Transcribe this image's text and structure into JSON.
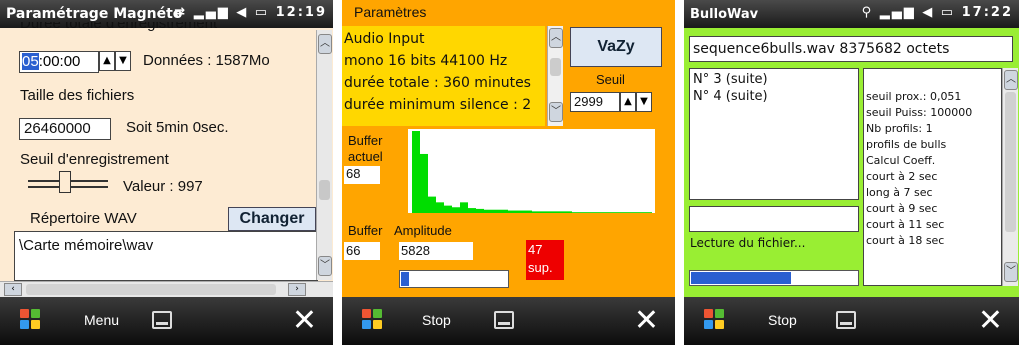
{
  "screen1": {
    "title": "Paramétrage Magnéto",
    "clock": "12:19",
    "partial_top_label": "Durée totale d'enregistrement",
    "duration_highlight": "05",
    "duration_rest": ":00:00",
    "data_label": "Données : 1587Mo",
    "file_size_label": "Taille des fichiers",
    "file_size_value": "26460000",
    "file_duration": "Soit 5min 0sec.",
    "threshold_label": "Seuil d'enregistrement",
    "threshold_value": "Valeur : 997",
    "threshold_fraction": 0.45,
    "wav_dir_label": "Répertoire WAV",
    "change_button": "Changer",
    "wav_path": "\\Carte mémoire\\wav",
    "menu_label": "Menu"
  },
  "screen2": {
    "params_label": "Paramètres",
    "input_lines": [
      "Audio Input",
      "mono 16 bits 44100 Hz",
      "durée totale : 360 minutes",
      "durée minimum silence : 2"
    ],
    "vazy_button": "VaZy",
    "seuil_label": "Seuil",
    "seuil_value": "2999",
    "buffer_actuel_label_1": "Buffer",
    "buffer_actuel_label_2": "actuel",
    "buffer_actuel_value": "68",
    "buffer_label": "Buffer",
    "amplitude_label": "Amplitude",
    "buffer_value": "66",
    "amplitude_value": "5828",
    "sup_value": "47",
    "sup_label": "sup.",
    "progress_fraction": 0.05,
    "stop_label": "Stop",
    "histogram": [
      100,
      72,
      20,
      13,
      9,
      7,
      13,
      6,
      5,
      4,
      4,
      4,
      3,
      3,
      3,
      2,
      2,
      2,
      2,
      2,
      1,
      1,
      1,
      1,
      1,
      1,
      1,
      1,
      1,
      1
    ],
    "colors": {
      "background": "#ffa500",
      "info_bg": "#ffd700",
      "bars": "#00dd00",
      "sup_bg": "#ee0000"
    }
  },
  "screen3": {
    "title": "BulloWav",
    "clock": "17:22",
    "file_line": "sequence6bulls.wav 8375682 octets",
    "list_items": [
      "N° 3 (suite)",
      "N° 4 (suite)"
    ],
    "params_lines": [
      "seuil prox.: 0,051",
      "seuil Puiss: 100000",
      "Nb profils: 1",
      "profils de bulls",
      "Calcul Coeff.",
      "court à 2 sec",
      "long à 7 sec",
      "court à 9 sec",
      "court à 11 sec",
      "court à 18 sec"
    ],
    "status_text": "Lecture du fichier...",
    "progress_fraction": 0.6,
    "stop_label": "Stop"
  }
}
